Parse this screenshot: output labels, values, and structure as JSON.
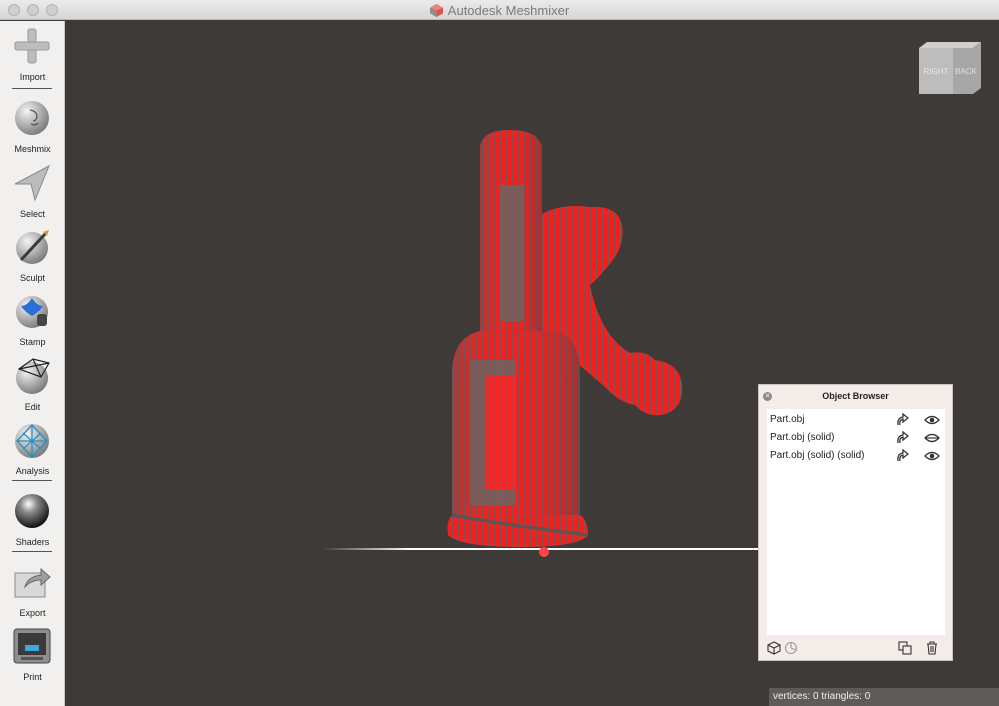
{
  "window": {
    "title": "Autodesk Meshmixer"
  },
  "toolbar": {
    "items": [
      {
        "label": "Import",
        "icon": "plus-icon"
      },
      {
        "label": "Meshmix",
        "icon": "meshmix-face-icon"
      },
      {
        "label": "Select",
        "icon": "select-arrow-icon"
      },
      {
        "label": "Sculpt",
        "icon": "sculpt-brush-icon"
      },
      {
        "label": "Stamp",
        "icon": "stamp-icon"
      },
      {
        "label": "Edit",
        "icon": "edit-mesh-icon"
      },
      {
        "label": "Analysis",
        "icon": "analysis-mesh-icon"
      },
      {
        "label": "Shaders",
        "icon": "shader-sphere-icon"
      },
      {
        "label": "Export",
        "icon": "export-icon"
      },
      {
        "label": "Print",
        "icon": "printer-icon"
      }
    ]
  },
  "viewcube": {
    "right": "RIGHT",
    "back": "BACK"
  },
  "object_browser": {
    "title": "Object Browser",
    "objects": [
      {
        "name": "Part.obj",
        "visible": true
      },
      {
        "name": "Part.obj (solid)",
        "visible": false
      },
      {
        "name": "Part.obj (solid) (solid)",
        "visible": true
      }
    ]
  },
  "status": {
    "text": "vertices: 0  triangles: 0"
  },
  "colors": {
    "viewport": "#3d3a37",
    "model_red": "#ff1010",
    "model_grey": "#6e6a68"
  }
}
